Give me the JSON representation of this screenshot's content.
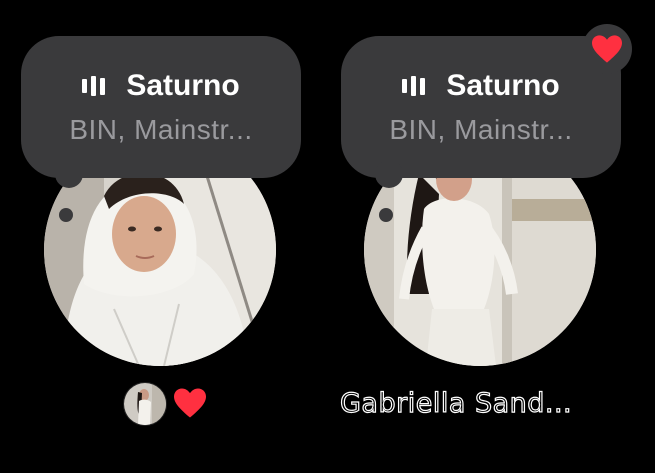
{
  "notes": [
    {
      "song_title": "Saturno",
      "song_meta": "BIN, Mainstr..."
    },
    {
      "song_title": "Saturno",
      "song_meta": "BIN, Mainstr..."
    }
  ],
  "right_user": {
    "name": "Gabriella Sand..."
  },
  "colors": {
    "background": "#000000",
    "bubble": "#3a3a3c",
    "meta_text": "#9a9a9e",
    "heart": "#ff3040"
  },
  "icons": {
    "music_bars": "music-bars-icon",
    "heart": "heart-icon"
  }
}
